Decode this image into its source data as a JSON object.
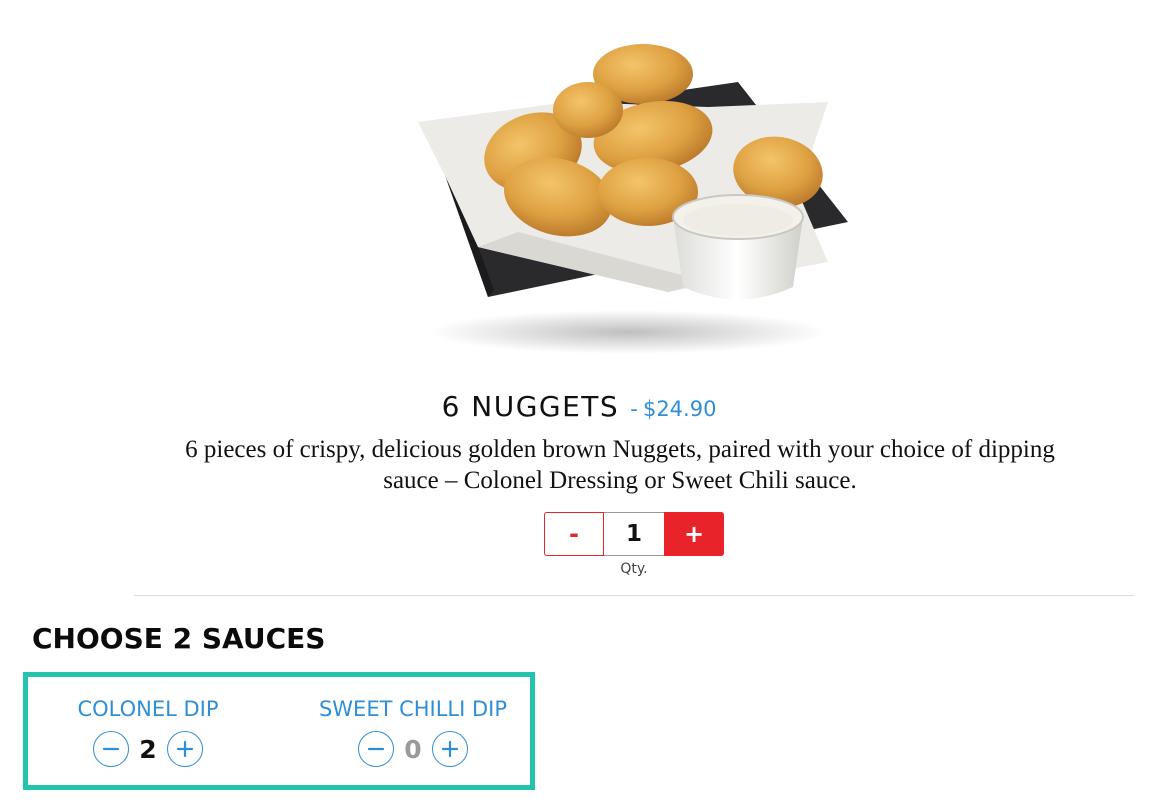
{
  "product": {
    "image_alt": "Nuggets with dipping sauce",
    "name": "6 NUGGETS",
    "price_separator": "-",
    "price": "$24.90",
    "description": "6 pieces of crispy, delicious golden brown Nuggets, paired with your choice of dipping sauce – Colonel Dressing or Sweet Chili sauce."
  },
  "quantity": {
    "minus_label": "-",
    "value": "1",
    "plus_label": "+",
    "label": "Qty."
  },
  "sauces": {
    "heading": "CHOOSE 2 SAUCES",
    "options": [
      {
        "name": "COLONEL DIP",
        "count": "2"
      },
      {
        "name": "SWEET CHILLI DIP",
        "count": "0"
      }
    ]
  },
  "colors": {
    "accent_blue": "#2f8fd6",
    "brand_red": "#e8232a",
    "highlight_teal": "#23c4ae"
  }
}
